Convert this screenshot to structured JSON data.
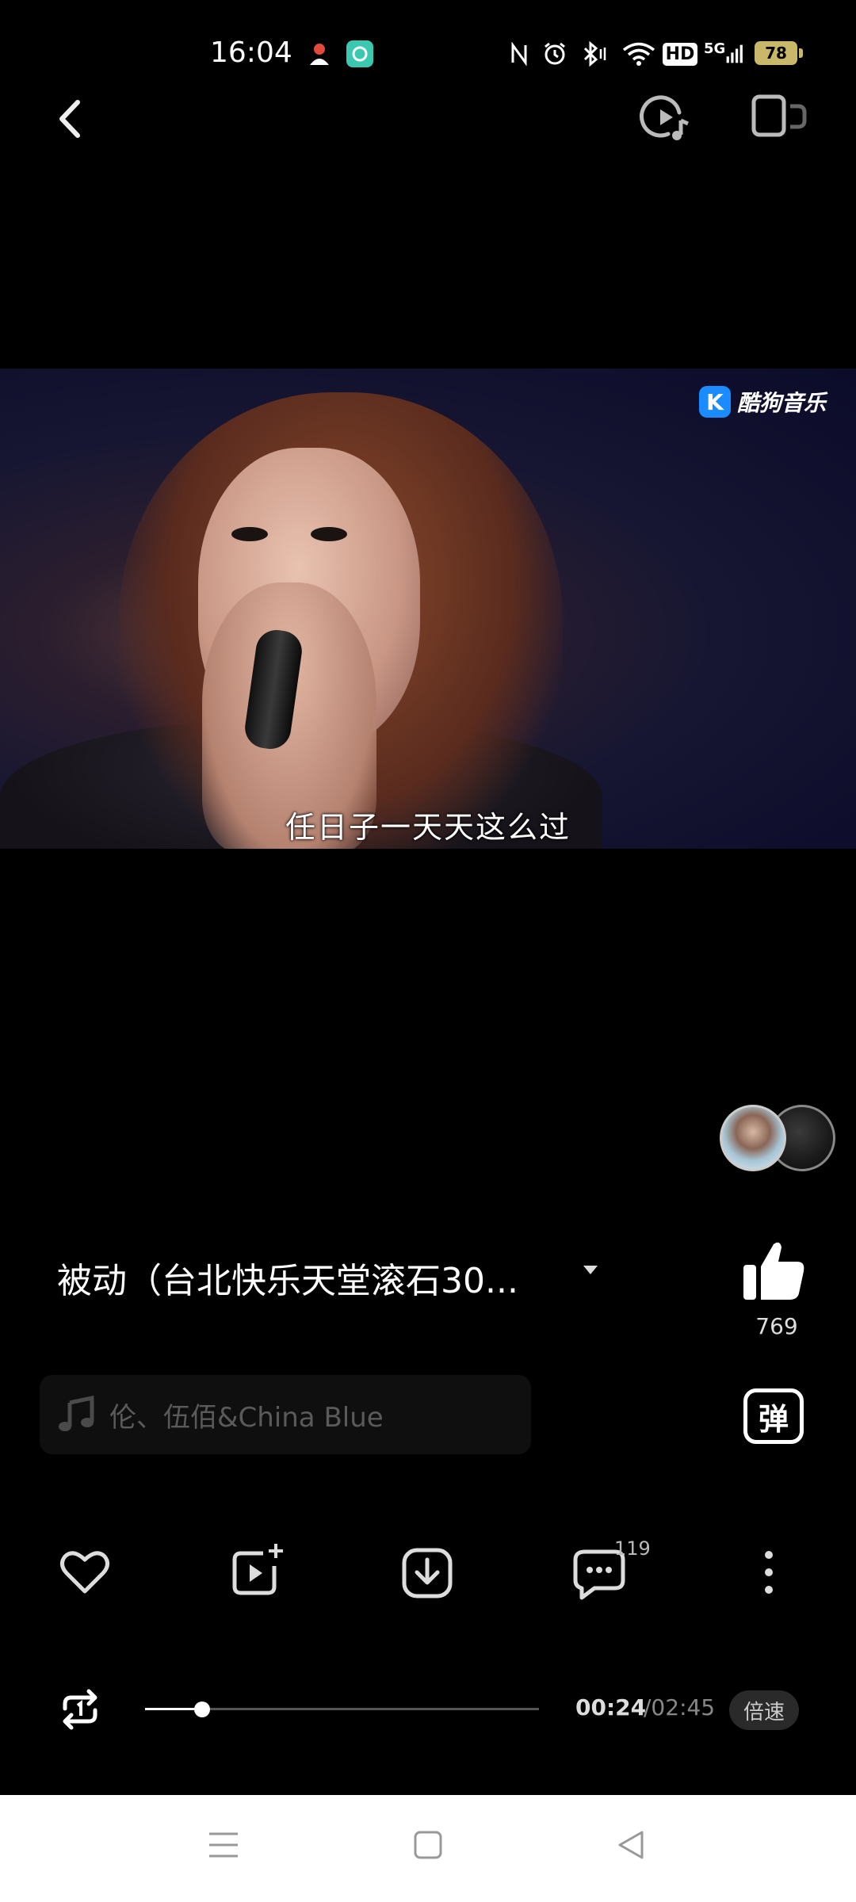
{
  "status_bar": {
    "time": "16:04",
    "hd_label": "HD",
    "network_label": "5G",
    "battery": "78"
  },
  "toolbar": {
    "icons": [
      "back-icon",
      "video-music-icon",
      "screen-cast-icon"
    ]
  },
  "video": {
    "watermark": "酷狗音乐",
    "watermark_logo": "K",
    "subtitle": "任日子一天天这么过"
  },
  "song": {
    "title": "被动（台北快乐天堂滚石30...",
    "artists": "伦、伍佰&China Blue",
    "likes": "769"
  },
  "danmu_label": "弹",
  "actions": {
    "comment_count": "119",
    "icons": [
      "heart-icon",
      "add-to-playlist-icon",
      "download-icon",
      "comment-icon",
      "more-icon"
    ]
  },
  "playback": {
    "current": "00:24",
    "total": "/02:45",
    "progress": 0.145,
    "speed_label": "倍速"
  },
  "colors": {
    "background": "#000000",
    "battery": "#c9b86a",
    "kugou_blue": "#1a8cff"
  }
}
